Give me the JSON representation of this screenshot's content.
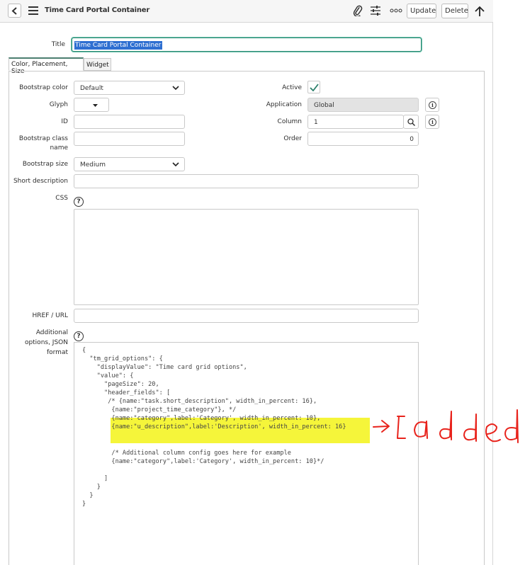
{
  "header": {
    "title": "Time Card Portal Container",
    "update_label": "Update",
    "delete_label": "Delete",
    "icons": [
      "back-icon",
      "menu-icon",
      "paperclip-icon",
      "settings-sliders-icon",
      "more-icon",
      "arrow-up-icon"
    ]
  },
  "form": {
    "title_label": "Title",
    "title_value": "Time Card Portal Container",
    "tabs": [
      {
        "label": "Color, Placement, Size",
        "active": true
      },
      {
        "label": "Widget",
        "active": false
      }
    ],
    "bootstrap_color": {
      "label": "Bootstrap color",
      "value": "Default"
    },
    "glyph": {
      "label": "Glyph",
      "value": ""
    },
    "id": {
      "label": "ID",
      "value": ""
    },
    "bootstrap_class_name": {
      "label_line1": "Bootstrap class",
      "label_line2": "name",
      "value": ""
    },
    "bootstrap_size": {
      "label": "Bootstrap size",
      "value": "Medium"
    },
    "short_description": {
      "label": "Short description",
      "value": ""
    },
    "css": {
      "label": "CSS",
      "value": ""
    },
    "href": {
      "label": "HREF / URL",
      "value": ""
    },
    "additional_options": {
      "label_line1": "Additional",
      "label_line2": "options, JSON",
      "label_line3": "format"
    },
    "active": {
      "label": "Active",
      "checked": true
    },
    "application": {
      "label": "Application",
      "value": "Global"
    },
    "column": {
      "label": "Column",
      "value": "1"
    },
    "order": {
      "label": "Order",
      "value": "0"
    }
  },
  "code_lines": [
    {
      "text": "{"
    },
    {
      "text": "  \"tm_grid_options\": {"
    },
    {
      "text": "    \"displayValue\": \"Time card grid options\","
    },
    {
      "text": "    \"value\": {"
    },
    {
      "text": "      \"pageSize\": 20,"
    },
    {
      "text": "      \"header_fields\": ["
    },
    {
      "text": "       /* {name:\"task.short_description\", width_in_percent: 16},"
    },
    {
      "text": "        {name:\"project_time_category\"}, */"
    },
    {
      "text": "        {name:\"category\",label:'Category', width_in_percent: 10},"
    },
    {
      "text": "        {name:\"u_description\",label:'Description', width_in_percent: 16}"
    },
    {
      "text": ""
    },
    {
      "text": ""
    },
    {
      "text": "        /* Additional column config goes here for example"
    },
    {
      "text": "        {name:\"category\",label:'Category', width_in_percent: 10}*/"
    },
    {
      "text": ""
    },
    {
      "text": "      ]"
    },
    {
      "text": "    }"
    },
    {
      "text": "  }"
    },
    {
      "text": "}"
    }
  ],
  "annotation": {
    "text": "added",
    "color": "#e8231c"
  },
  "colors": {
    "highlight": "#f5f53a",
    "focus_border": "#2a8a74",
    "selection": "#2e6fd1"
  }
}
